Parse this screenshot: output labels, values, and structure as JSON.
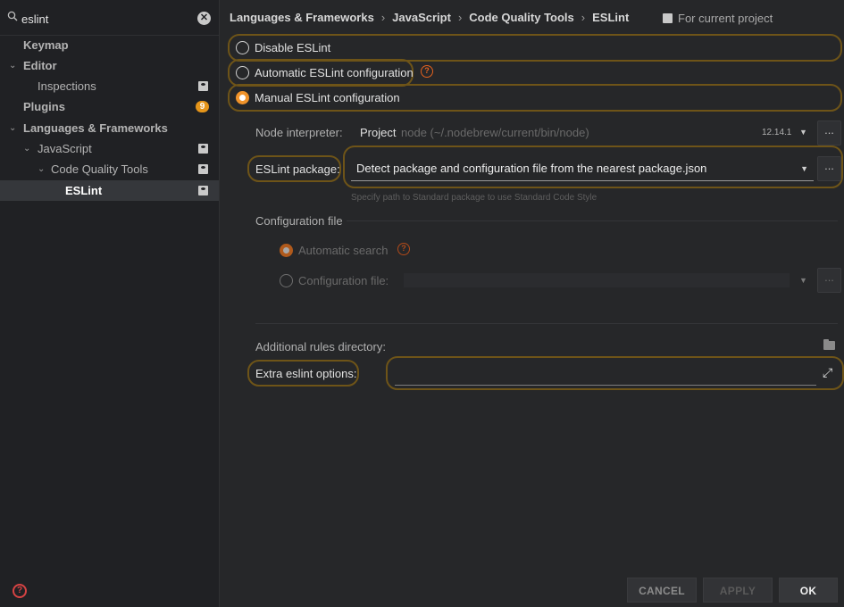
{
  "search": {
    "value": "eslint",
    "clear_glyph": "✕"
  },
  "sidebar": {
    "items": [
      {
        "label": "Keymap"
      },
      {
        "label": "Editor"
      },
      {
        "label": "Inspections"
      },
      {
        "label": "Plugins",
        "badge": "9"
      },
      {
        "label": "Languages & Frameworks"
      },
      {
        "label": "JavaScript"
      },
      {
        "label": "Code Quality Tools"
      },
      {
        "label": "ESLint"
      }
    ],
    "chevron_expanded": "⌄"
  },
  "breadcrumb": {
    "items": [
      "Languages & Frameworks",
      "JavaScript",
      "Code Quality Tools",
      "ESLint"
    ],
    "separator": "›"
  },
  "for_project": "For current project",
  "radios": {
    "disable": "Disable ESLint",
    "automatic": "Automatic ESLint configuration",
    "manual": "Manual ESLint configuration",
    "selected": "manual"
  },
  "help_glyph": "?",
  "node": {
    "label": "Node interpreter:",
    "project": "Project",
    "path": "node (~/.nodebrew/current/bin/node)",
    "version": "12.14.1",
    "arrow": "▼"
  },
  "package": {
    "label": "ESLint package:",
    "value": "Detect package and configuration file from the nearest package.json",
    "hint": "Specify path to Standard package to use Standard Code Style",
    "arrow": "▼"
  },
  "ellipsis": "...",
  "config": {
    "section": "Configuration file",
    "automatic": "Automatic search",
    "file_label": "Configuration file:",
    "arrow": "▼"
  },
  "rules": {
    "label": "Additional rules directory:"
  },
  "extra": {
    "label": "Extra eslint options:",
    "value": "",
    "expand_glyph": "⤢"
  },
  "footer": {
    "cancel": "CANCEL",
    "apply": "APPLY",
    "ok": "OK"
  },
  "colors": {
    "accent": "#f0932a",
    "highlight": "#6e5418",
    "badge": "#e5951a"
  }
}
